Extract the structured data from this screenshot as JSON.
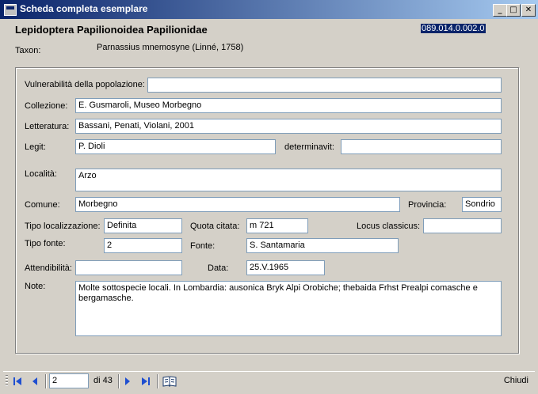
{
  "window": {
    "title": "Scheda completa esemplare"
  },
  "header": {
    "heading": "Lepidoptera Papilionoidea Papilionidae",
    "code": "089.014.0.002.0",
    "taxon_label": "Taxon:",
    "taxon_value": "Parnassius mnemosyne (Linné, 1758)"
  },
  "form": {
    "vulnerabilita": {
      "label": "Vulnerabilità della popolazione:",
      "value": ""
    },
    "collezione": {
      "label": "Collezione:",
      "value": "E. Gusmaroli, Museo Morbegno"
    },
    "letteratura": {
      "label": "Letteratura:",
      "value": "Bassani, Penati, Violani, 2001"
    },
    "legit": {
      "label": "Legit:",
      "value": "P. Dioli"
    },
    "determinavit": {
      "label": "determinavit:",
      "value": ""
    },
    "localita": {
      "label": "Località:",
      "value": "Arzo"
    },
    "comune": {
      "label": "Comune:",
      "value": "Morbegno"
    },
    "provincia": {
      "label": "Provincia:",
      "value": "Sondrio"
    },
    "tipo_localizzazione": {
      "label": "Tipo localizzazione:",
      "value": "Definita"
    },
    "quota_citata": {
      "label": "Quota citata:",
      "value": "m 721"
    },
    "locus_classicus": {
      "label": "Locus classicus:",
      "value": ""
    },
    "tipo_fonte": {
      "label": "Tipo fonte:",
      "value": "2"
    },
    "fonte": {
      "label": "Fonte:",
      "value": "S. Santamaria"
    },
    "attendibilita": {
      "label": "Attendibilità:",
      "value": ""
    },
    "data": {
      "label": "Data:",
      "value": "25.V.1965"
    },
    "note": {
      "label": "Note:",
      "value": "Molte sottospecie locali. In Lombardia: ausonica Bryk Alpi Orobiche; thebaida Frhst Prealpi comasche e bergamasche."
    }
  },
  "navigator": {
    "position": "2",
    "of_label": "di 43",
    "close_label": "Chiudi"
  },
  "colors": {
    "title_bar": "#0a246a",
    "nav_icon": "#1f4fd0",
    "background": "#d4d0c8"
  },
  "icons": [
    "first-record-icon",
    "previous-record-icon",
    "next-record-icon",
    "last-record-icon",
    "book-icon"
  ]
}
